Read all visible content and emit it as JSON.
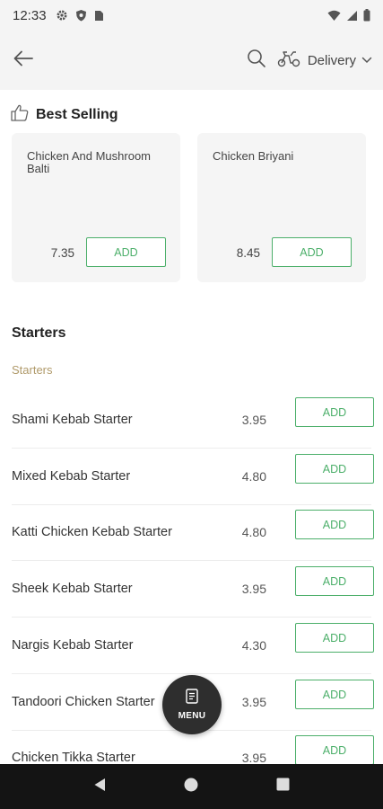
{
  "status_bar": {
    "time": "12:33",
    "left_icons": [
      "gear-icon",
      "shield-icon",
      "sim-card-icon"
    ],
    "right_icons": [
      "wifi-icon",
      "signal-icon",
      "battery-icon"
    ]
  },
  "app_bar": {
    "back_icon": "arrow-left-icon",
    "search_icon": "search-icon",
    "delivery_icon": "scooter-icon",
    "delivery_label": "Delivery",
    "delivery_chevron": "chevron-down-icon"
  },
  "best_selling": {
    "icon": "thumbs-up-icon",
    "title": "Best Selling",
    "items": [
      {
        "name": "Chicken And Mushroom Balti",
        "price": "7.35",
        "add_label": "ADD"
      },
      {
        "name": "Chicken Briyani",
        "price": "8.45",
        "add_label": "ADD"
      }
    ]
  },
  "starters": {
    "title": "Starters",
    "subtitle": "Starters",
    "items": [
      {
        "name": "Shami Kebab Starter",
        "price": "3.95",
        "add_label": "ADD"
      },
      {
        "name": "Mixed Kebab Starter",
        "price": "4.80",
        "add_label": "ADD"
      },
      {
        "name": "Katti Chicken Kebab Starter",
        "price": "4.80",
        "add_label": "ADD"
      },
      {
        "name": "Sheek Kebab Starter",
        "price": "3.95",
        "add_label": "ADD"
      },
      {
        "name": "Nargis Kebab Starter",
        "price": "4.30",
        "add_label": "ADD"
      },
      {
        "name": "Tandoori Chicken Starter",
        "price": "3.95",
        "add_label": "ADD"
      },
      {
        "name": "Chicken Tikka Starter",
        "price": "3.95",
        "add_label": "ADD"
      }
    ]
  },
  "menu_fab": {
    "icon": "menu-document-icon",
    "label": "MENU"
  },
  "nav_bar": {
    "icons": [
      "back-triangle-icon",
      "home-circle-icon",
      "recents-square-icon"
    ]
  },
  "colors": {
    "accent_green": "#4caf6a",
    "subtitle_gold": "#b09a6a",
    "fab_dark": "#2e2e2e",
    "nav_bg": "#141414"
  }
}
